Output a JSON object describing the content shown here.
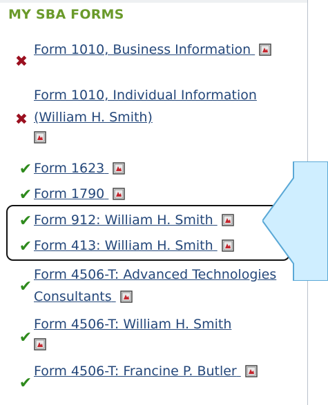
{
  "heading": "MY SBA FORMS",
  "forms": [
    {
      "label": "Form 1010, Business Information",
      "status": "incomplete"
    },
    {
      "label": "Form 1010, Individual Information (William H. Smith)",
      "status": "incomplete"
    },
    {
      "label": "Form 1623",
      "status": "complete"
    },
    {
      "label": "Form 1790",
      "status": "complete"
    },
    {
      "label": "Form 912: William H. Smith",
      "status": "complete"
    },
    {
      "label": "Form 413: William H. Smith",
      "status": "complete"
    },
    {
      "label": "Form 4506-T: Advanced Technologies Consultants",
      "status": "complete"
    },
    {
      "label": "Form 4506-T: William H. Smith",
      "status": "complete"
    },
    {
      "label": "Form 4506-T: Francine P. Butler",
      "status": "complete"
    }
  ],
  "colors": {
    "heading": "#6a9a2a",
    "link": "#24477a",
    "incomplete": "#9b0f1f",
    "complete": "#2e8a1c",
    "callout_fill": "#cfeeff",
    "callout_stroke": "#5aa8d6"
  },
  "icons": {
    "incomplete": "x-mark-icon",
    "complete": "checkmark-icon",
    "pdf": "pdf-document-icon"
  }
}
